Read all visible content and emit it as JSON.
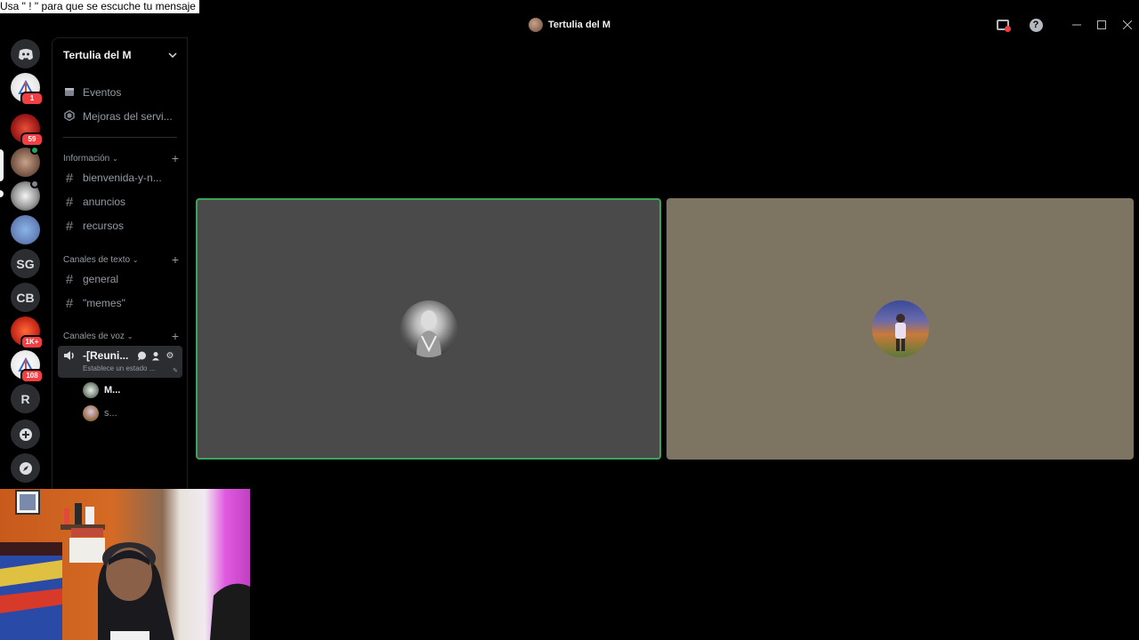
{
  "overlay": {
    "text": "Usa \" ! \" para que se escuche tu mensaje"
  },
  "window": {
    "title": "Tertulia del M",
    "help_glyph": "?"
  },
  "servers": [
    {
      "type": "image",
      "badge": "1"
    },
    {
      "type": "image",
      "badge": "59"
    },
    {
      "type": "image",
      "badge": ""
    },
    {
      "type": "image",
      "badge": ""
    },
    {
      "type": "image",
      "badge": ""
    },
    {
      "type": "text",
      "label": "SG"
    },
    {
      "type": "text",
      "label": "CB"
    },
    {
      "type": "image",
      "badge": "1K+"
    },
    {
      "type": "image",
      "badge": "108"
    },
    {
      "type": "text",
      "label": "R"
    }
  ],
  "sidebar": {
    "server_name": "Tertulia del M",
    "top_items": [
      {
        "label": "Eventos",
        "icon": "calendar-icon"
      },
      {
        "label": "Mejoras del servi...",
        "icon": "boost-icon"
      }
    ],
    "categories": [
      {
        "label": "Información",
        "channels": [
          "bienvenida-y-n...",
          "anuncios",
          "recursos"
        ]
      },
      {
        "label": "Canales de texto",
        "channels": [
          "general",
          "\"memes\""
        ]
      },
      {
        "label": "Canales de voz"
      }
    ],
    "voice_channel": {
      "name": "-[Reuni...",
      "status": "Establece un estado ...",
      "users": [
        "M...",
        "s..."
      ]
    }
  },
  "colors": {
    "speaking_border": "#3ba55c",
    "tile1_bg": "#4a4a4a",
    "tile2_bg": "#7d7461",
    "badge_red": "#f23f43"
  }
}
